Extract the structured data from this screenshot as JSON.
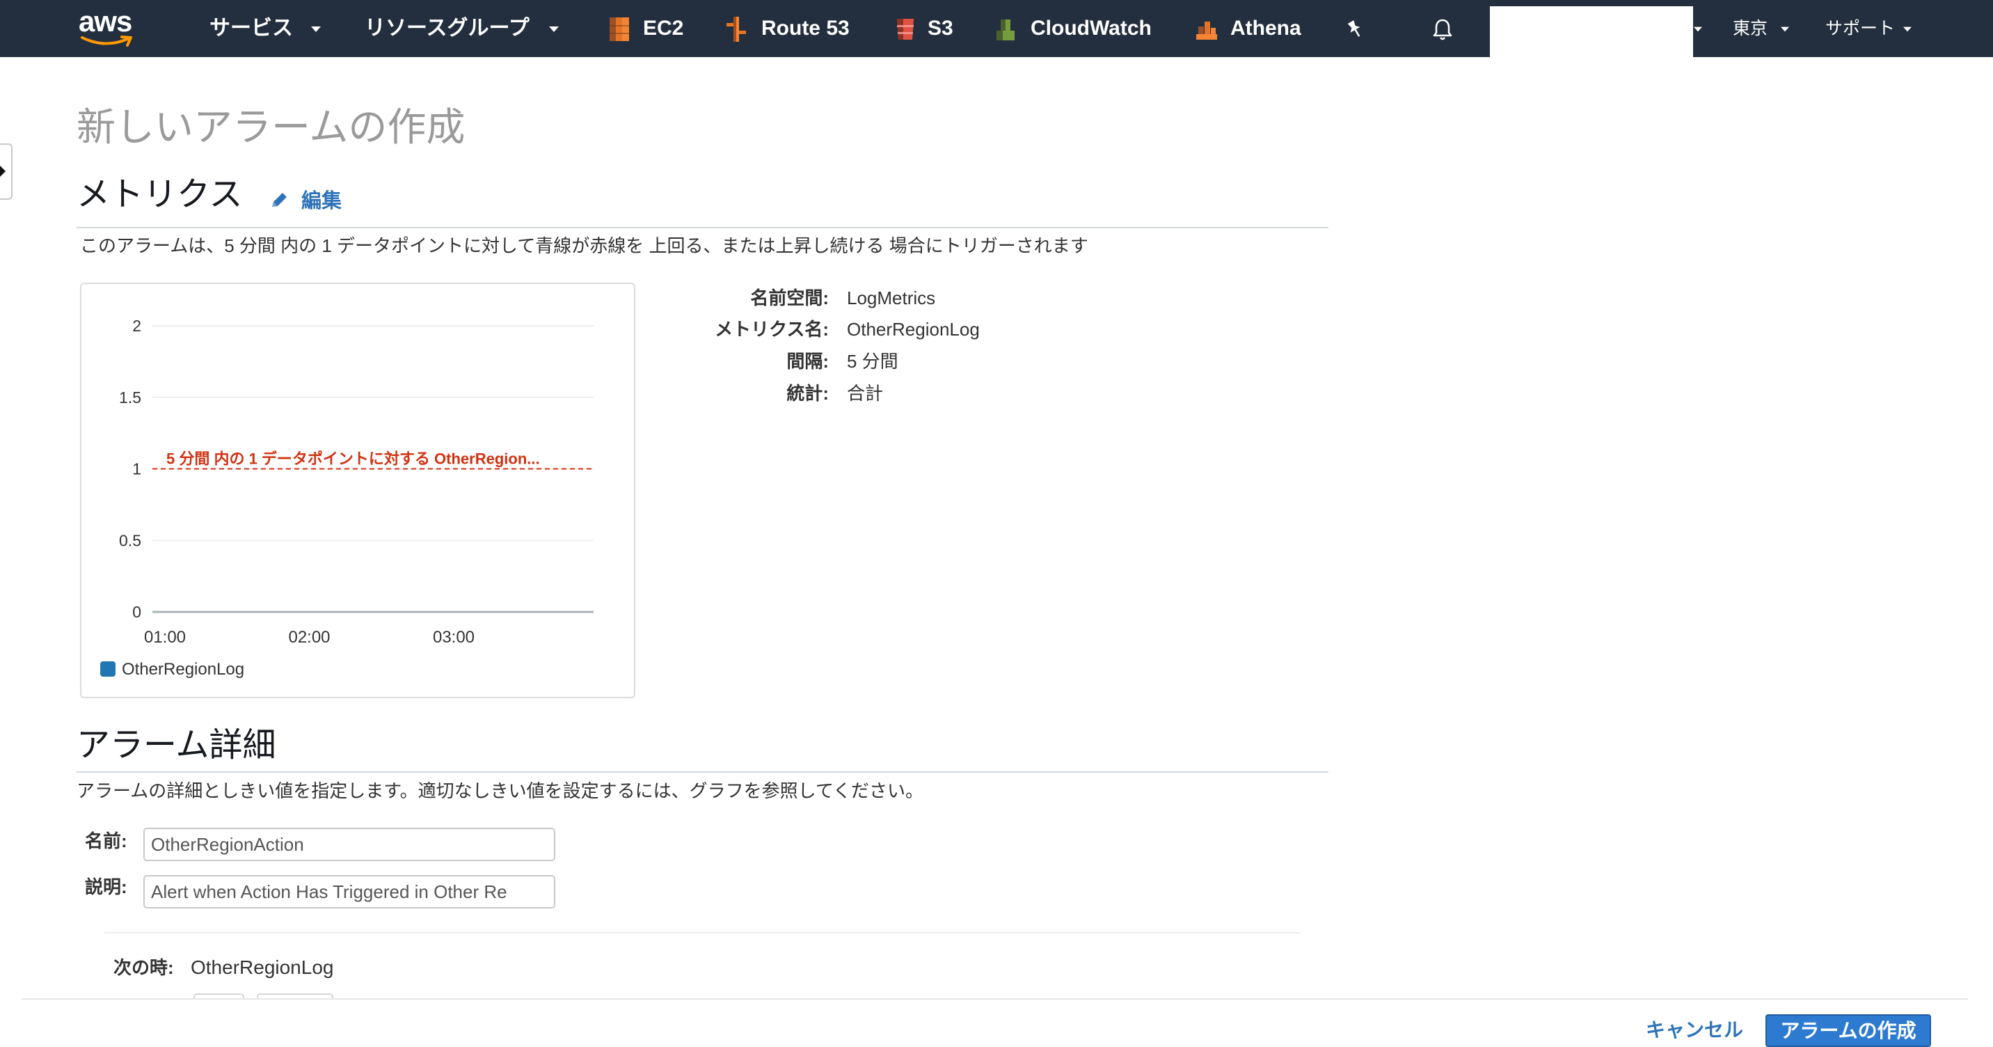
{
  "colors": {
    "nav_bg": "#232f3e",
    "link": "#2e73b8",
    "primary_button": "#2d7bd1",
    "threshold": "#d13212",
    "series": "#1f77b4",
    "title_gray": "#9a9a9a"
  },
  "nav": {
    "logo_text": "aws",
    "services_label": "サービス",
    "resource_groups_label": "リソースグループ",
    "shortcuts": [
      {
        "label": "EC2",
        "icon": "ec2-icon"
      },
      {
        "label": "Route 53",
        "icon": "route53-icon"
      },
      {
        "label": "S3",
        "icon": "s3-icon"
      },
      {
        "label": "CloudWatch",
        "icon": "cloudwatch-icon"
      },
      {
        "label": "Athena",
        "icon": "athena-icon"
      }
    ],
    "pin_icon": "pin-icon",
    "notifications_icon": "bell-icon",
    "region_label": "東京",
    "support_label": "サポート"
  },
  "page": {
    "title": "新しいアラームの作成"
  },
  "metrics": {
    "heading": "メトリクス",
    "edit_label": "編集",
    "edit_icon": "pencil-icon",
    "description": "このアラームは、5 分間 内の 1 データポイントに対して青線が赤線を 上回る、または上昇し続ける 場合にトリガーされます",
    "details": [
      {
        "label": "名前空間:",
        "value": "LogMetrics"
      },
      {
        "label": "メトリクス名:",
        "value": "OtherRegionLog"
      },
      {
        "label": "間隔:",
        "value": "5 分間"
      },
      {
        "label": "統計:",
        "value": "合計"
      }
    ]
  },
  "chart_data": {
    "type": "line",
    "x_ticks": [
      "01:00",
      "02:00",
      "03:00"
    ],
    "y_ticks": [
      0,
      0.5,
      1,
      1.5,
      2
    ],
    "ylim": [
      0,
      2
    ],
    "grid": true,
    "legend": "bottom-left",
    "threshold": {
      "value": 1,
      "label": "5 分間 内の 1 データポイントに対する OtherRegion..."
    },
    "series": [
      {
        "name": "OtherRegionLog",
        "values": []
      }
    ]
  },
  "alarm": {
    "heading": "アラーム詳細",
    "description": "アラームの詳細としきい値を指定します。適切なしきい値を設定するには、グラフを参照してください。",
    "name_label": "名前:",
    "name_value": "OtherRegionAction",
    "description_label": "説明:",
    "description_value": "Alert when Action Has Triggered in Other Re",
    "when_label": "次の時:",
    "when_value": "OtherRegionLog"
  },
  "footer": {
    "cancel_label": "キャンセル",
    "create_label": "アラームの作成"
  }
}
